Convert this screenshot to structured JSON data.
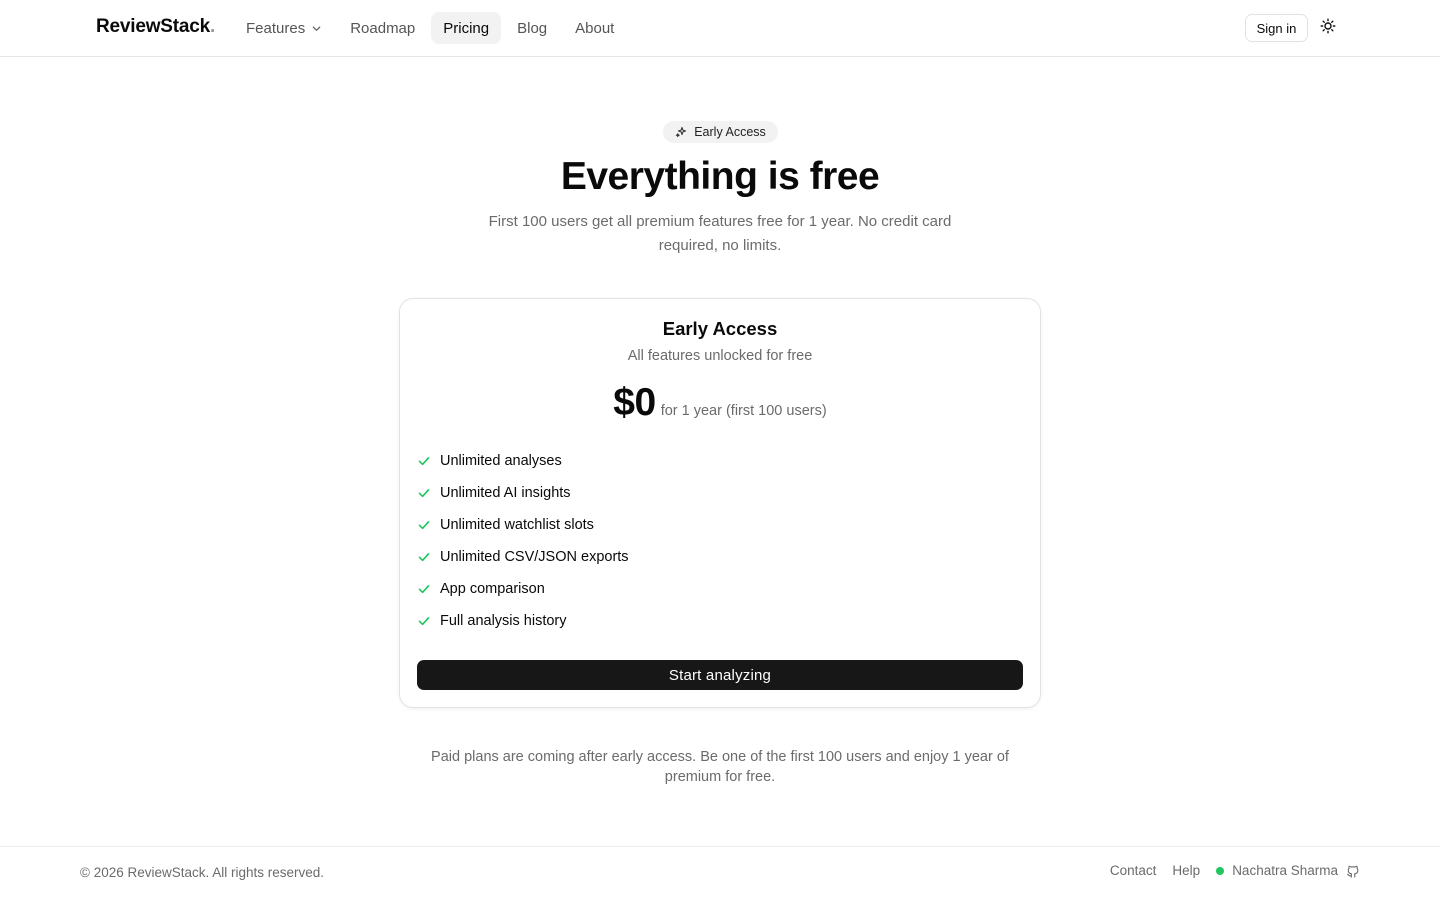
{
  "header": {
    "brand": "ReviewStack",
    "brand_dot": ".",
    "nav": [
      {
        "label": "Features"
      },
      {
        "label": "Roadmap"
      },
      {
        "label": "Pricing",
        "active": true
      },
      {
        "label": "Blog"
      },
      {
        "label": "About"
      }
    ],
    "signin_label": "Sign in",
    "theme_icon": "sun-icon"
  },
  "hero": {
    "badge": "Early Access",
    "badge_icon": "sparkles-icon",
    "title": "Everything is free",
    "subtitle": "First 100 users get all premium features free for 1 year. No credit card required, no limits."
  },
  "plan": {
    "title": "Early Access",
    "subtitle": "All features unlocked for free",
    "price": "$0",
    "price_note": "for 1 year (first 100 users)",
    "features": [
      "Unlimited analyses",
      "Unlimited AI insights",
      "Unlimited watchlist slots",
      "Unlimited CSV/JSON exports",
      "App comparison",
      "Full analysis history"
    ],
    "cta_label": "Start analyzing",
    "check_color": "#22c55e"
  },
  "note": "Paid plans are coming after early access. Be one of the first 100 users and enjoy 1 year of premium for free.",
  "footer": {
    "copyright": "© 2026 ReviewStack. All rights reserved.",
    "links": [
      "Contact",
      "Help"
    ],
    "author": "Nachatra Sharma",
    "status_color": "#22c55e",
    "author_icon": "github-icon"
  }
}
